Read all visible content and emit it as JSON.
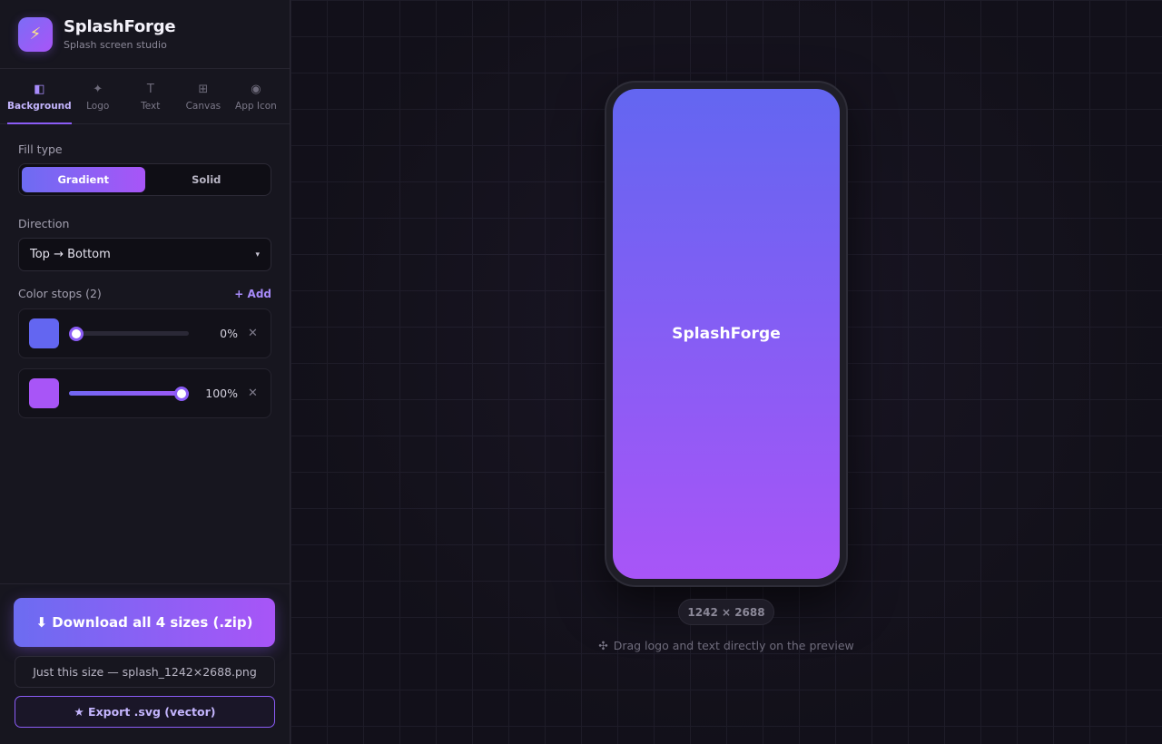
{
  "brand": {
    "title": "SplashForge",
    "subtitle": "Splash screen studio",
    "logo_icon": "⚡"
  },
  "tabs": [
    {
      "icon": "◧",
      "label": "Background",
      "active": true
    },
    {
      "icon": "✦",
      "label": "Logo",
      "active": false
    },
    {
      "icon": "T",
      "label": "Text",
      "active": false
    },
    {
      "icon": "⊞",
      "label": "Canvas",
      "active": false
    },
    {
      "icon": "◉",
      "label": "App Icon",
      "active": false
    }
  ],
  "background": {
    "fill_type_label": "Fill type",
    "fill_options": {
      "gradient": "Gradient",
      "solid": "Solid",
      "selected": "Gradient"
    },
    "direction_label": "Direction",
    "direction_value": "Top → Bottom",
    "caret": "▾",
    "color_stops_label": "Color stops (2)",
    "add_label": "+ Add",
    "stops": [
      {
        "color": "#6366f1",
        "position": 0,
        "position_label": "0%",
        "remove": "✕"
      },
      {
        "color": "#a855f7",
        "position": 100,
        "position_label": "100%",
        "remove": "✕"
      }
    ]
  },
  "actions": {
    "download_all": "⬇ Download all 4 sizes (.zip)",
    "just_this_size": "Just this size — splash_1242×2688.png",
    "export_svg": "★ Export .svg (vector)"
  },
  "preview": {
    "text": "SplashForge",
    "gradient_from": "#6366f1",
    "gradient_to": "#a855f7",
    "size_label": "1242 × 2688",
    "hint_icon": "✣",
    "hint": "Drag logo and text directly on the preview"
  },
  "colors": {
    "accent": "#8b5cf6",
    "accent_light": "#a78bfa"
  }
}
